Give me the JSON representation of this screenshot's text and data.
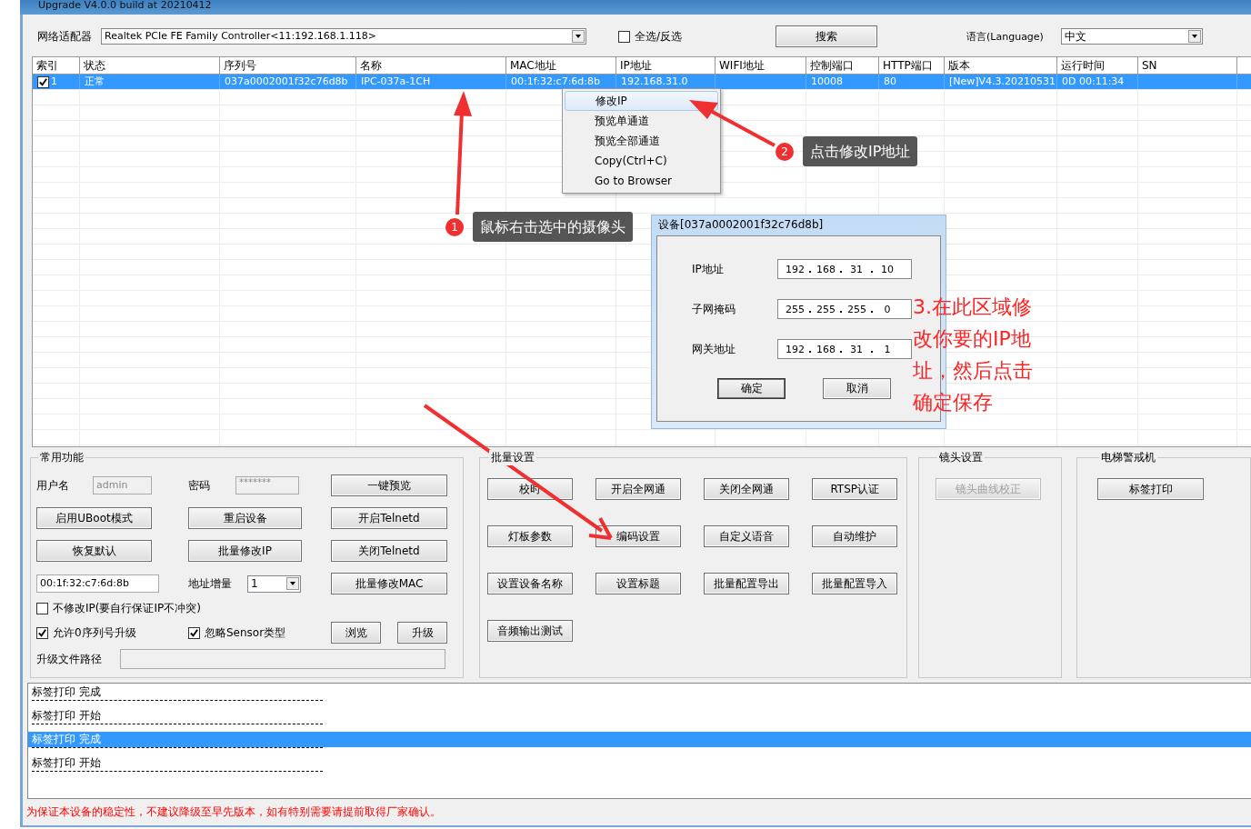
{
  "window": {
    "title": "Upgrade V4.0.0 build at 20210412"
  },
  "toolbar": {
    "adapter_label": "网络适配器",
    "adapter_value": "Realtek PCIe FE Family Controller<11:192.168.1.118>",
    "select_all": {
      "label": "全选/反选",
      "checked": false
    },
    "search_button": "搜索",
    "language_label": "语言(Language)",
    "language_value": "中文"
  },
  "table": {
    "columns": [
      "索引",
      "状态",
      "序列号",
      "名称",
      "MAC地址",
      "IP地址",
      "WIFI地址",
      "控制端口",
      "HTTP端口",
      "版本",
      "运行时间",
      "SN"
    ],
    "rows": [
      {
        "selected": true,
        "checked": true,
        "cells": [
          "1",
          "正常",
          "037a0002001f32c76d8b",
          "IPC-037a-1CH",
          "00:1f:32:c7:6d:8b",
          "192.168.31.0",
          "",
          "10008",
          "80",
          "[New]V4.3.20210531",
          "0D 00:11:34",
          ""
        ]
      }
    ]
  },
  "common": {
    "title": "常用功能",
    "username": {
      "label": "用户名",
      "value": "admin"
    },
    "password": {
      "label": "密码",
      "value": "*******"
    },
    "preview_button": "一键预览",
    "button_rows": [
      [
        "启用UBoot模式",
        "重启设备",
        "开启Telnetd"
      ],
      [
        "恢复默认",
        "批量修改IP",
        "关闭Telnetd"
      ]
    ],
    "mac_value": "00:1f:32:c7:6d:8b",
    "increment_label": "地址增量",
    "increment_value": "1",
    "mac_button": "批量修改MAC",
    "options": [
      {
        "label": "不修改IP(要自行保证IP不冲突)",
        "checked": false
      },
      {
        "label": "允许0序列号升级",
        "checked": true
      },
      {
        "label": "忽略Sensor类型",
        "checked": true
      }
    ],
    "browse_button": "浏览",
    "upgrade_button": "升级",
    "path_label": "升级文件路径"
  },
  "batch": {
    "title": "批量设置",
    "buttons": [
      "校时",
      "开启全网通",
      "关闭全网通",
      "RTSP认证",
      "灯板参数",
      "编码设置",
      "自定义语音",
      "自动维护",
      "设置设备名称",
      "设置标题",
      "批量配置导出",
      "批量配置导入",
      "音频输出测试"
    ]
  },
  "lens": {
    "title": "镜头设置",
    "buttons": [
      {
        "label": "镜头曲线校正",
        "disabled": true
      }
    ]
  },
  "elevator": {
    "title": "电梯警戒机",
    "buttons": [
      {
        "label": "标签打印",
        "disabled": false
      }
    ]
  },
  "log": [
    {
      "text": "标签打印 完成",
      "selected": false
    },
    {
      "text": "标签打印 开始",
      "selected": false
    },
    {
      "text": "标签打印 完成",
      "selected": true
    },
    {
      "text": "标签打印 开始",
      "selected": false
    }
  ],
  "status": "为保证本设备的稳定性，不建议降级至早先版本，如有特别需要请提前取得厂家确认。",
  "context_menu": [
    {
      "label": "修改IP",
      "selected": true
    },
    {
      "label": "预览单通道",
      "selected": false
    },
    {
      "label": "预览全部通道",
      "selected": false
    },
    {
      "label": "Copy(Ctrl+C)",
      "selected": false
    },
    {
      "label": "Go to Browser",
      "selected": false
    }
  ],
  "dialog": {
    "title": "设备[037a0002001f32c76d8b]",
    "fields": [
      {
        "label": "IP地址",
        "octets": [
          "192",
          "168",
          "31",
          "10"
        ]
      },
      {
        "label": "子网掩码",
        "octets": [
          "255",
          "255",
          "255",
          "0"
        ]
      },
      {
        "label": "网关地址",
        "octets": [
          "192",
          "168",
          "31",
          "1"
        ]
      }
    ],
    "buttons": [
      "确定",
      "取消"
    ]
  },
  "annotations": {
    "callouts": [
      {
        "number": "1",
        "text": "鼠标右击选中的摄像头"
      },
      {
        "number": "2",
        "text": "点击修改IP地址"
      }
    ],
    "note": "3.在此区域修改你要的IP地址，然后点击确定保存"
  }
}
